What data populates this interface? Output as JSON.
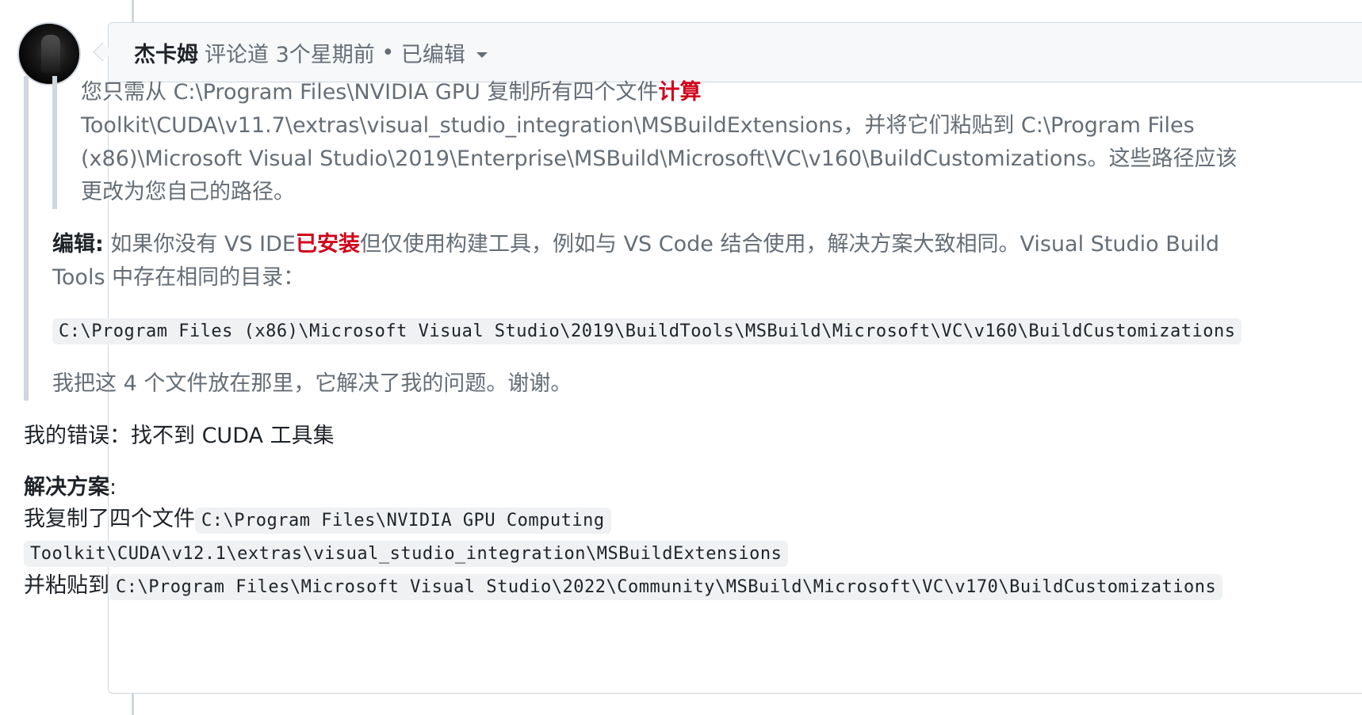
{
  "comment": {
    "author": "杰卡姆",
    "action": "评论道",
    "time": "3个星期前",
    "separator": "•",
    "edited": "已编辑"
  },
  "quote": {
    "inner": {
      "text_before": "您只需从 C:\\Program Files\\NVIDIA GPU 复制所有四个文件",
      "highlight": "计算",
      "text_after": "Toolkit\\CUDA\\v11.7\\extras\\visual_studio_integration\\MSBuildExtensions，并将它们粘贴到 C:\\Program Files (x86)\\Microsoft Visual Studio\\2019\\Enterprise\\MSBuild\\Microsoft\\VC\\v160\\BuildCustomizations。这些路径应该更改为您自己的路径。"
    },
    "edit_label": "编辑:",
    "edit_before": "如果你没有 VS IDE",
    "edit_highlight": "已安装",
    "edit_after": "但仅使用构建工具，例如与 VS Code 结合使用，解决方案大致相同。Visual Studio Build Tools 中存在相同的目录：",
    "code_path": "C:\\Program Files (x86)\\Microsoft Visual Studio\\2019\\BuildTools\\MSBuild\\Microsoft\\VC\\v160\\BuildCustomizations",
    "thanks": "我把这 4 个文件放在那里，它解决了我的问题。谢谢。"
  },
  "error_line": "我的错误：找不到 CUDA 工具集",
  "solution": {
    "title": "解决方案",
    "colon": ":",
    "copy_prefix": "我复制了四个文件",
    "copy_code_1": "C:\\Program Files\\NVIDIA GPU Computing ",
    "copy_code_2": "Toolkit\\CUDA\\v12.1\\extras\\visual_studio_integration\\MSBuildExtensions",
    "paste_prefix": "并粘贴到",
    "paste_code": "C:\\Program Files\\Microsoft Visual Studio\\2022\\Community\\MSBuild\\Microsoft\\VC\\v170\\BuildCustomizations"
  },
  "colors": {
    "highlight": "#d0021b",
    "border": "#d0d7de",
    "header_bg": "#f6f8fa",
    "code_bg": "#eff1f3"
  }
}
